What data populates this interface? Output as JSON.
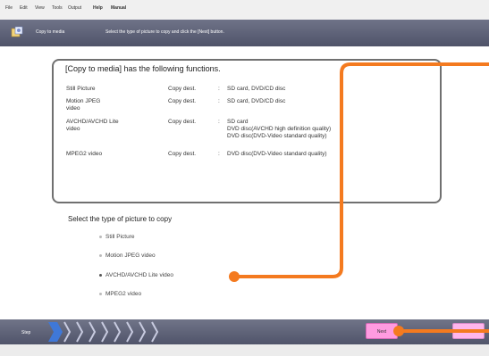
{
  "menu": [
    "File",
    "Edit",
    "View",
    "Tools",
    "Output",
    "Help",
    "Manual"
  ],
  "header": {
    "title": "Copy to media",
    "instruction": "Select the type of picture to copy and click the [Next] button."
  },
  "functions": {
    "heading": "[Copy to media] has the following functions.",
    "rows": [
      {
        "type": "Still Picture",
        "dest_label": "Copy dest.",
        "colon": ":",
        "dest": "SD card, DVD/CD disc"
      },
      {
        "type": "Motion JPEG\nvideo",
        "dest_label": "Copy dest.",
        "colon": ":",
        "dest": "SD card, DVD/CD disc"
      },
      {
        "type": "AVCHD/AVCHD Lite\nvideo",
        "dest_label": "Copy dest.",
        "colon": ":",
        "dest": "SD card\nDVD disc(AVCHD high definition quality)\nDVD disc(DVD-Video standard quality)"
      },
      {
        "type": "MPEG2 video",
        "dest_label": "Copy dest.",
        "colon": ":",
        "dest": "DVD disc(DVD-Video standard quality)"
      }
    ]
  },
  "select": {
    "heading": "Select the type of picture to copy",
    "options": [
      {
        "label": "Still Picture",
        "selected": false
      },
      {
        "label": "Motion JPEG video",
        "selected": false
      },
      {
        "label": "AVCHD/AVCHD Lite video",
        "selected": true
      },
      {
        "label": "MPEG2 video",
        "selected": false
      }
    ]
  },
  "footer": {
    "step_label": "Step",
    "next_label": "Next"
  },
  "colors": {
    "callout": "#f47a1f",
    "button_pink": "#ff9be0"
  }
}
